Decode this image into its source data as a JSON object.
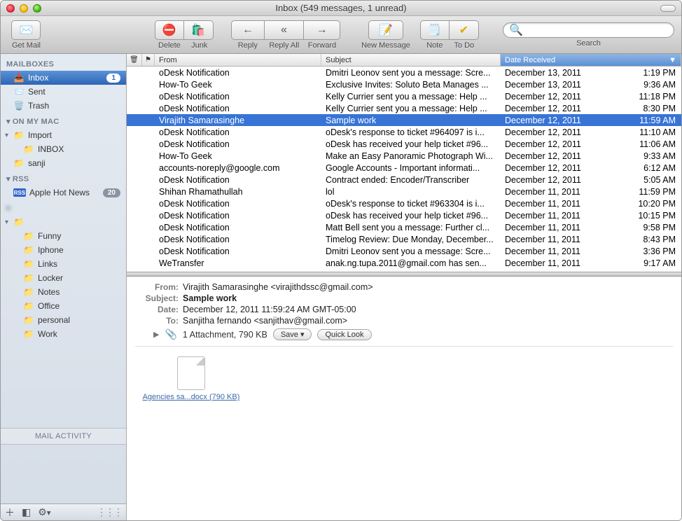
{
  "window": {
    "title": "Inbox (549 messages, 1 unread)"
  },
  "toolbar": {
    "get_mail": "Get Mail",
    "delete": "Delete",
    "junk": "Junk",
    "reply": "Reply",
    "reply_all": "Reply All",
    "forward": "Forward",
    "new_message": "New Message",
    "note": "Note",
    "to_do": "To Do",
    "search_label": "Search",
    "search_placeholder": ""
  },
  "sidebar": {
    "mailboxes_header": "MAILBOXES",
    "inbox": {
      "label": "Inbox",
      "badge": "1"
    },
    "sent": {
      "label": "Sent"
    },
    "trash": {
      "label": "Trash"
    },
    "on_my_mac_header": "ON MY MAC",
    "import": {
      "label": "Import"
    },
    "import_inbox": {
      "label": "INBOX"
    },
    "sanji": {
      "label": "sanji"
    },
    "rss_header": "RSS",
    "apple_hot_news": {
      "label": "Apple Hot News",
      "badge": "20"
    },
    "hidden_header": "",
    "hidden_folder": {
      "label": ""
    },
    "funny": {
      "label": "Funny"
    },
    "iphone": {
      "label": "Iphone"
    },
    "links": {
      "label": "Links"
    },
    "locker": {
      "label": "Locker"
    },
    "notes": {
      "label": "Notes"
    },
    "office": {
      "label": "Office"
    },
    "personal": {
      "label": "personal"
    },
    "work": {
      "label": "Work"
    },
    "mail_activity": "MAIL ACTIVITY"
  },
  "columns": {
    "from": "From",
    "subject": "Subject",
    "date_received": "Date Received"
  },
  "messages": [
    {
      "from": "oDesk Notification",
      "subject": "Dmitri Leonov sent you a message: Scre...",
      "date": "December 13, 2011",
      "time": "1:19 PM",
      "selected": false
    },
    {
      "from": "How-To Geek",
      "subject": "Exclusive Invites: Soluto Beta Manages ...",
      "date": "December 13, 2011",
      "time": "9:36 AM",
      "selected": false
    },
    {
      "from": "oDesk Notification",
      "subject": "Kelly Currier sent you a message: Help ...",
      "date": "December 12, 2011",
      "time": "11:18 PM",
      "selected": false
    },
    {
      "from": "oDesk Notification",
      "subject": "Kelly Currier sent you a message: Help ...",
      "date": "December 12, 2011",
      "time": "8:30 PM",
      "selected": false
    },
    {
      "from": "Virajith Samarasinghe",
      "subject": "Sample work",
      "date": "December 12, 2011",
      "time": "11:59 AM",
      "selected": true
    },
    {
      "from": "oDesk Notification",
      "subject": "oDesk's response to ticket #964097 is i...",
      "date": "December 12, 2011",
      "time": "11:10 AM",
      "selected": false
    },
    {
      "from": "oDesk Notification",
      "subject": "oDesk has received your help ticket #96...",
      "date": "December 12, 2011",
      "time": "11:06 AM",
      "selected": false
    },
    {
      "from": "How-To Geek",
      "subject": "Make an Easy Panoramic Photograph Wi...",
      "date": "December 12, 2011",
      "time": "9:33 AM",
      "selected": false
    },
    {
      "from": "accounts-noreply@google.com",
      "subject": "Google Accounts - Important informati...",
      "date": "December 12, 2011",
      "time": "6:12 AM",
      "selected": false
    },
    {
      "from": "oDesk Notification",
      "subject": "Contract ended: Encoder/Transcriber",
      "date": "December 12, 2011",
      "time": "5:05 AM",
      "selected": false
    },
    {
      "from": "Shihan Rhamathullah",
      "subject": "lol",
      "date": "December 11, 2011",
      "time": "11:59 PM",
      "selected": false
    },
    {
      "from": "oDesk Notification",
      "subject": "oDesk's response to ticket #963304 is i...",
      "date": "December 11, 2011",
      "time": "10:20 PM",
      "selected": false
    },
    {
      "from": "oDesk Notification",
      "subject": "oDesk has received your help ticket #96...",
      "date": "December 11, 2011",
      "time": "10:15 PM",
      "selected": false
    },
    {
      "from": "oDesk Notification",
      "subject": "Matt Bell sent you a message: Further cl...",
      "date": "December 11, 2011",
      "time": "9:58 PM",
      "selected": false
    },
    {
      "from": "oDesk Notification",
      "subject": "Timelog Review: Due Monday, December...",
      "date": "December 11, 2011",
      "time": "8:43 PM",
      "selected": false
    },
    {
      "from": "oDesk Notification",
      "subject": "Dmitri Leonov sent you a message: Scre...",
      "date": "December 11, 2011",
      "time": "3:36 PM",
      "selected": false
    },
    {
      "from": "WeTransfer",
      "subject": "anak.ng.tupa.2011@gmail.com has sen...",
      "date": "December 11, 2011",
      "time": "9:17 AM",
      "selected": false
    }
  ],
  "preview": {
    "labels": {
      "from": "From:",
      "subject": "Subject:",
      "date": "Date:",
      "to": "To:"
    },
    "from": "Virajith Samarasinghe <virajithdssc@gmail.com>",
    "subject": "Sample work",
    "date": "December 12, 2011 11:59:24 AM GMT-05:00",
    "to": "Sanjitha fernando <sanjithav@gmail.com>",
    "attachments_summary": "1 Attachment, 790 KB",
    "save_btn": "Save ▾",
    "quicklook_btn": "Quick Look",
    "attachment_name": "Agencies sa...docx (790 KB)"
  }
}
